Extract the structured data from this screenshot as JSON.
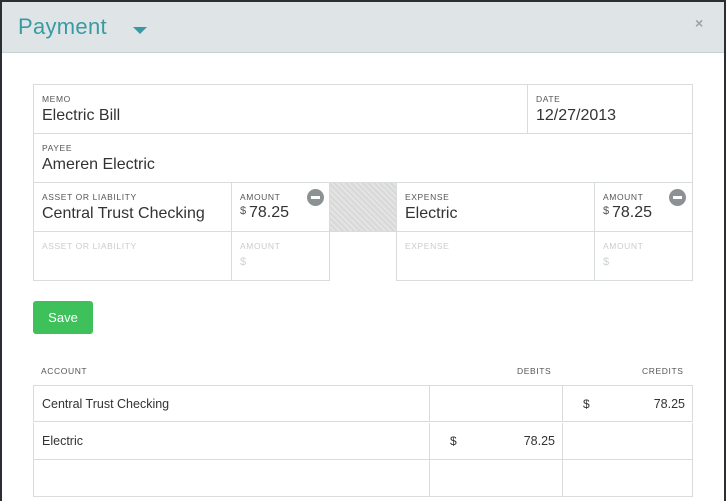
{
  "modal": {
    "title": "Payment",
    "close_label": "×"
  },
  "form": {
    "memo": {
      "label": "MEMO",
      "value": "Electric Bill"
    },
    "date": {
      "label": "DATE",
      "value": "12/27/2013"
    },
    "payee": {
      "label": "PAYEE",
      "value": "Ameren Electric"
    },
    "left_rows": [
      {
        "account_label": "ASSET OR LIABILITY",
        "account_value": "Central Trust Checking",
        "amount_label": "AMOUNT",
        "currency": "$",
        "amount_value": "78.25"
      },
      {
        "account_label": "ASSET OR LIABILITY",
        "account_value": "",
        "amount_label": "AMOUNT",
        "currency": "$",
        "amount_value": ""
      }
    ],
    "right_rows": [
      {
        "account_label": "EXPENSE",
        "account_value": "Electric",
        "amount_label": "AMOUNT",
        "currency": "$",
        "amount_value": "78.25"
      },
      {
        "account_label": "EXPENSE",
        "account_value": "",
        "amount_label": "AMOUNT",
        "currency": "$",
        "amount_value": ""
      }
    ]
  },
  "save_label": "Save",
  "ledger": {
    "headers": {
      "account": "ACCOUNT",
      "debits": "DEBITS",
      "credits": "CREDITS"
    },
    "rows": [
      {
        "account": "Central Trust Checking",
        "debit_currency": "",
        "debit": "",
        "credit_currency": "$",
        "credit": "78.25"
      },
      {
        "account": "Electric",
        "debit_currency": "$",
        "debit": "78.25",
        "credit_currency": "",
        "credit": ""
      },
      {
        "account": "",
        "debit_currency": "",
        "debit": "",
        "credit_currency": "",
        "credit": ""
      }
    ]
  },
  "colors": {
    "accent": "#3a9aa3",
    "save_button": "#3ec15b",
    "header_bg": "#dfe5e6"
  },
  "icons": {
    "title_menu": "caret-down-icon",
    "close": "close-icon",
    "remove_row": "minus-circle-icon"
  }
}
